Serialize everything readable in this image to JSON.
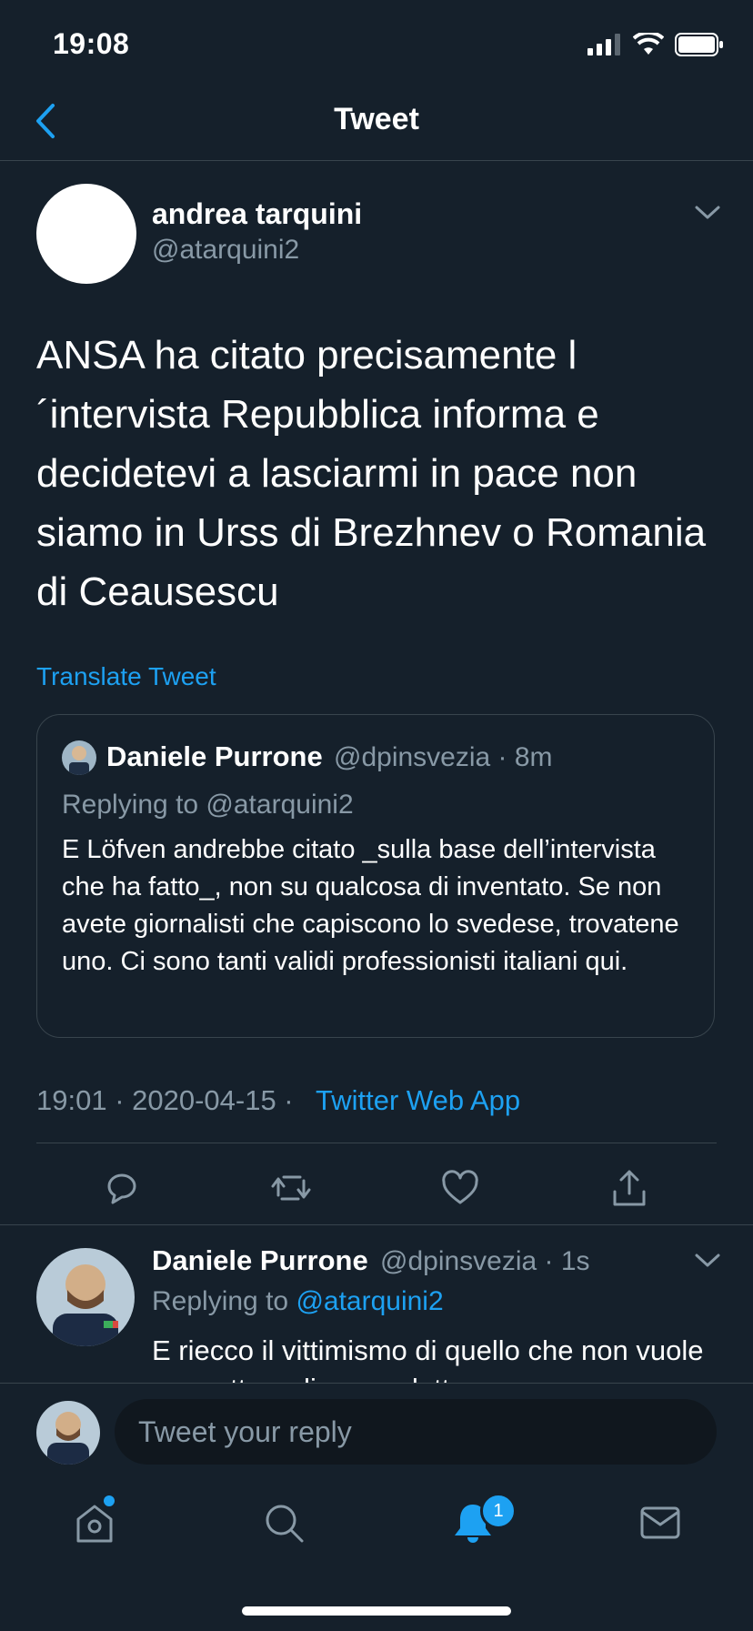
{
  "status_bar": {
    "time": "19:08"
  },
  "nav": {
    "title": "Tweet"
  },
  "tweet": {
    "author_name": "andrea tarquini",
    "author_handle": "@atarquini2",
    "text": "ANSA ha citato precisamente l ´intervista Repubblica informa e decidetevi a lasciarmi in pace non siamo in Urss di Brezhnev o Romania di Ceausescu",
    "translate_label": "Translate Tweet",
    "timestamp": "19:01 · 2020-04-15 · ",
    "source": "Twitter Web App"
  },
  "quoted_tweet": {
    "author_name": "Daniele Purrone",
    "author_handle_time": "@dpinsvezia · 8m",
    "replying_to": "Replying to @atarquini2",
    "text": "E Löfven andrebbe citato _sulla base dell’intervista che ha fatto_, non su qualcosa di inventato. Se non avete giornalisti che capiscono lo svedese, trovatene uno. Ci sono tanti validi professionisti italiani qui."
  },
  "reply": {
    "author_name": "Daniele Purrone",
    "author_handle_time": "@dpinsvezia · 1s",
    "replying_prefix": "Replying to ",
    "replying_handle": "@atarquini2",
    "text": "E riecco il vittimismo di quello che non vuole ammettere di avere detto cose non"
  },
  "composer": {
    "placeholder": "Tweet your reply"
  },
  "tab_bar": {
    "notification_count": "1"
  },
  "colors": {
    "background": "#15202b",
    "accent": "#1da1f2",
    "secondary_text": "#8899a6",
    "divider": "#38444d"
  }
}
